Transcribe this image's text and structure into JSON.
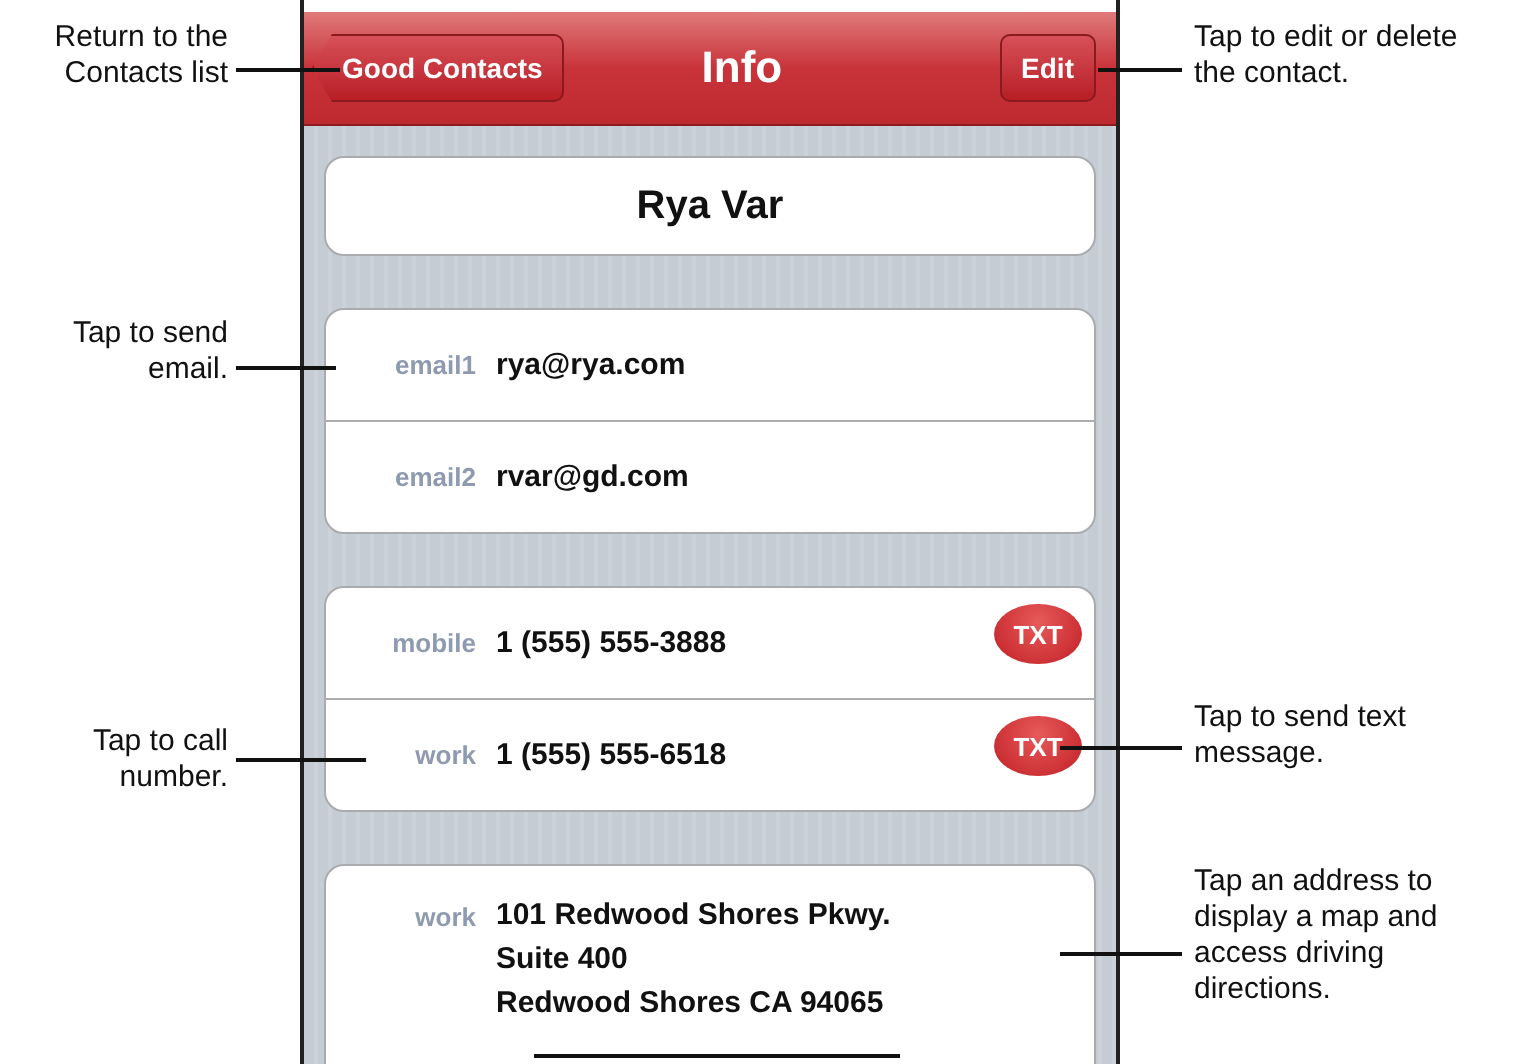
{
  "nav_bar": {
    "back_button": "Good Contacts",
    "title": "Info",
    "edit_button": "Edit"
  },
  "contact_name": "Rya Var",
  "emails": [
    {
      "label": "email1",
      "value": "rya@rya.com"
    },
    {
      "label": "email2",
      "value": "rvar@gd.com"
    }
  ],
  "phones": [
    {
      "label": "mobile",
      "value": "1 (555) 555-3888",
      "badge": "TXT"
    },
    {
      "label": "work",
      "value": "1 (555) 555-6518",
      "badge": "TXT"
    }
  ],
  "address": {
    "label": "work",
    "lines": [
      "101 Redwood Shores Pkwy.",
      "Suite 400",
      "Redwood Shores CA 94065"
    ]
  },
  "callouts": [
    {
      "kind": "left",
      "text": "Return to the\nContacts list"
    },
    {
      "kind": "left",
      "text": "Tap to send\nemail."
    },
    {
      "kind": "left",
      "text": "Tap to call\nnumber."
    },
    {
      "kind": "right",
      "text": "Tap to edit or delete\nthe contact."
    },
    {
      "kind": "right",
      "text": "Tap to send text\nmessage."
    },
    {
      "kind": "right",
      "text": "Tap an address to\ndisplay a map and\naccess driving\ndirections."
    }
  ]
}
